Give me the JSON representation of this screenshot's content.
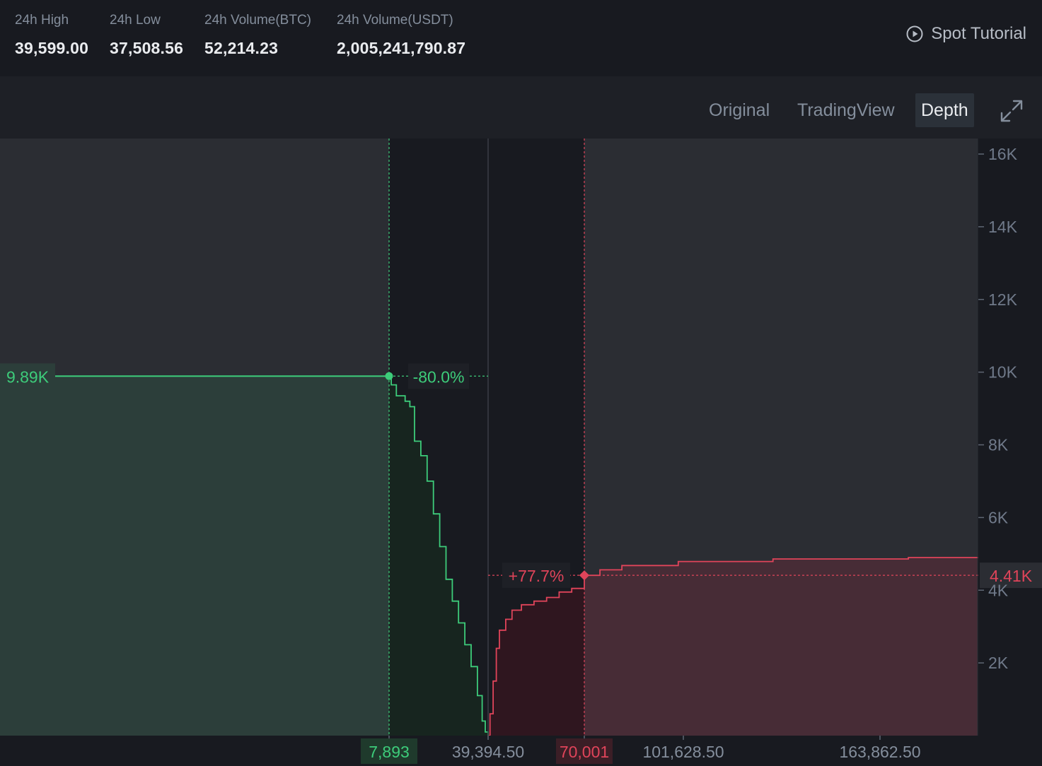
{
  "stats": [
    {
      "label": "24h High",
      "value": "39,599.00"
    },
    {
      "label": "24h Low",
      "value": "37,508.56"
    },
    {
      "label": "24h Volume(BTC)",
      "value": "52,214.23"
    },
    {
      "label": "24h Volume(USDT)",
      "value": "2,005,241,790.87"
    }
  ],
  "tutorial_label": "Spot Tutorial",
  "tabs": [
    {
      "label": "Original",
      "active": false
    },
    {
      "label": "TradingView",
      "active": false
    },
    {
      "label": "Depth",
      "active": true
    }
  ],
  "icons": {
    "tutorial": "play-circle-icon",
    "expand": "expand-arrows-icon"
  },
  "colors": {
    "bid": "#2ebd85",
    "bid_line": "#3dcc7a",
    "ask": "#f6465d",
    "ask_line": "#e0445a",
    "bid_fill_outer": "#2c3e3a",
    "bid_fill_inner": "#17251f",
    "ask_fill_outer": "#472c36",
    "ask_fill_inner": "#2f161f"
  },
  "chart_data": {
    "type": "area",
    "title": "",
    "xlabel": "",
    "ylabel": "",
    "x_ticks": [
      "7,893",
      "39,394.50",
      "70,001",
      "101,628.50",
      "163,862.50"
    ],
    "y_ticks": [
      "2K",
      "4K",
      "6K",
      "8K",
      "10K",
      "12K",
      "14K",
      "16K"
    ],
    "ylim": [
      0,
      16000
    ],
    "mid_price": 39394.5,
    "bid_marker": {
      "price": 7893,
      "depth": 9890,
      "price_label": "7,893",
      "depth_label": "9.89K",
      "pct_label": "-80.0%"
    },
    "ask_marker": {
      "price": 70001,
      "depth": 4410,
      "price_label": "70,001",
      "depth_label": "4.41K",
      "pct_label": "+77.7%"
    },
    "series": [
      {
        "name": "bids",
        "x": [
          0,
          7893,
          8600,
          10200,
          13000,
          14500,
          16000,
          18000,
          20000,
          22000,
          24000,
          26000,
          28000,
          30000,
          32000,
          34000,
          36000,
          37500,
          38500,
          39394.5
        ],
        "y": [
          9890,
          9890,
          9650,
          9350,
          9200,
          9050,
          8100,
          7700,
          7000,
          6100,
          5200,
          4300,
          3700,
          3100,
          2500,
          1900,
          1100,
          400,
          100,
          0
        ]
      },
      {
        "name": "asks",
        "x": [
          39394.5,
          40000,
          41000,
          42000,
          43000,
          45000,
          47000,
          50000,
          54000,
          58000,
          62000,
          66000,
          70001,
          75000,
          82000,
          100000,
          130000,
          170000,
          185000
        ],
        "y": [
          0,
          600,
          1500,
          2400,
          2900,
          3200,
          3450,
          3600,
          3700,
          3800,
          3950,
          4050,
          4410,
          4560,
          4680,
          4790,
          4860,
          4900,
          4910
        ]
      }
    ]
  }
}
